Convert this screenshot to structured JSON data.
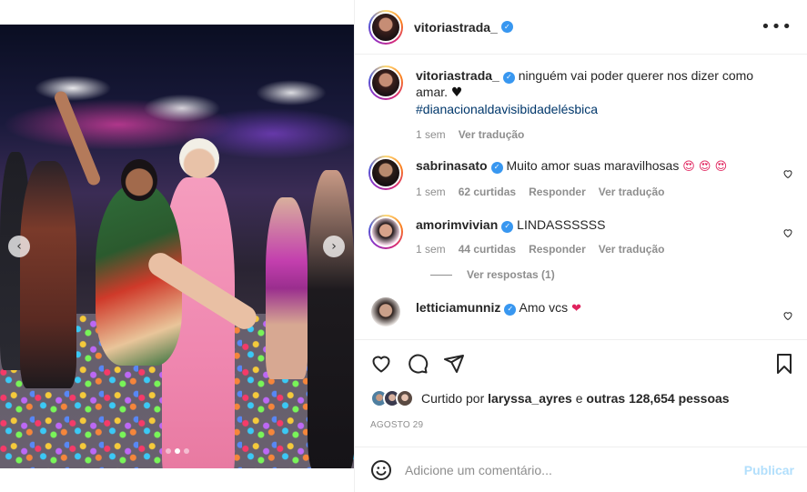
{
  "post": {
    "username": "vitoriastrada_",
    "more_label": "•••"
  },
  "media": {
    "prev_label": "‹",
    "next_label": "›",
    "dots_count": 3,
    "active_dot": 1
  },
  "caption": {
    "username": "vitoriastrada_",
    "text": "ninguém vai poder querer nos dizer como amar.",
    "emoji": "♥",
    "hashtag": "#dianacionaldavisibidadelésbica",
    "time": "1 sem",
    "translate": "Ver tradução"
  },
  "comments": [
    {
      "username": "sabrinasato",
      "text": "Muito amor suas maravilhosas",
      "emoji": "😍 😍 😍",
      "time": "1 sem",
      "likes": "62 curtidas",
      "reply": "Responder",
      "translate": "Ver tradução"
    },
    {
      "username": "amorimvivian",
      "text": "LINDASSSSSS",
      "emoji": "",
      "time": "1 sem",
      "likes": "44 curtidas",
      "reply": "Responder",
      "translate": "Ver tradução",
      "view_replies": "Ver respostas (1)"
    },
    {
      "username": "letticiamunniz",
      "text": "Amo vcs",
      "emoji": "❤"
    }
  ],
  "likes": {
    "prefix": "Curtido por",
    "user": "laryssa_ayres",
    "conjunction": "e",
    "others": "outras 128,654 pessoas"
  },
  "date": "AGOSTO 29",
  "add_comment": {
    "placeholder": "Adicione um comentário...",
    "publish_label": "Publicar"
  },
  "colors": {
    "verified": "#3897f0",
    "hashtag": "#00376b",
    "muted": "#8e8e8e",
    "publish_disabled": "#b2dffc"
  }
}
